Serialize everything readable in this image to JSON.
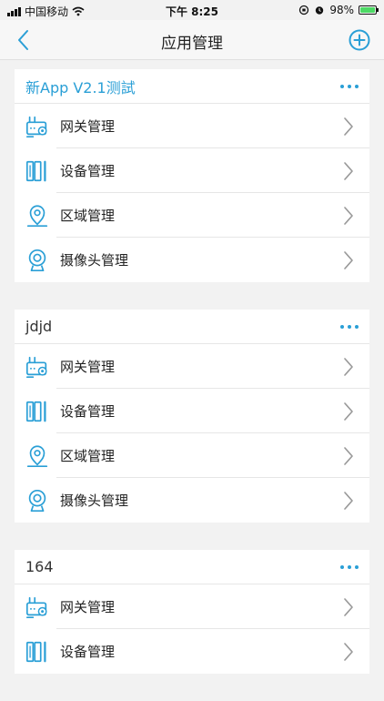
{
  "status_bar": {
    "carrier": "中国移动",
    "time": "下午 8:25",
    "battery": "98%",
    "battery_level": 0.98
  },
  "nav": {
    "title": "应用管理",
    "back_icon": "chevron-left-icon",
    "add_icon": "plus-circle-icon"
  },
  "colors": {
    "accent": "#2a9fd6",
    "background": "#f2f2f2"
  },
  "groups": [
    {
      "title": "新App  V2.1测試",
      "items": [
        {
          "label": "网关管理",
          "icon": "gateway-icon"
        },
        {
          "label": "设备管理",
          "icon": "device-icon"
        },
        {
          "label": "区域管理",
          "icon": "location-icon"
        },
        {
          "label": "摄像头管理",
          "icon": "camera-icon"
        }
      ]
    },
    {
      "title": "jdjd",
      "items": [
        {
          "label": "网关管理",
          "icon": "gateway-icon"
        },
        {
          "label": "设备管理",
          "icon": "device-icon"
        },
        {
          "label": "区域管理",
          "icon": "location-icon"
        },
        {
          "label": "摄像头管理",
          "icon": "camera-icon"
        }
      ]
    },
    {
      "title": "164",
      "items": [
        {
          "label": "网关管理",
          "icon": "gateway-icon"
        },
        {
          "label": "设备管理",
          "icon": "device-icon"
        }
      ]
    }
  ]
}
